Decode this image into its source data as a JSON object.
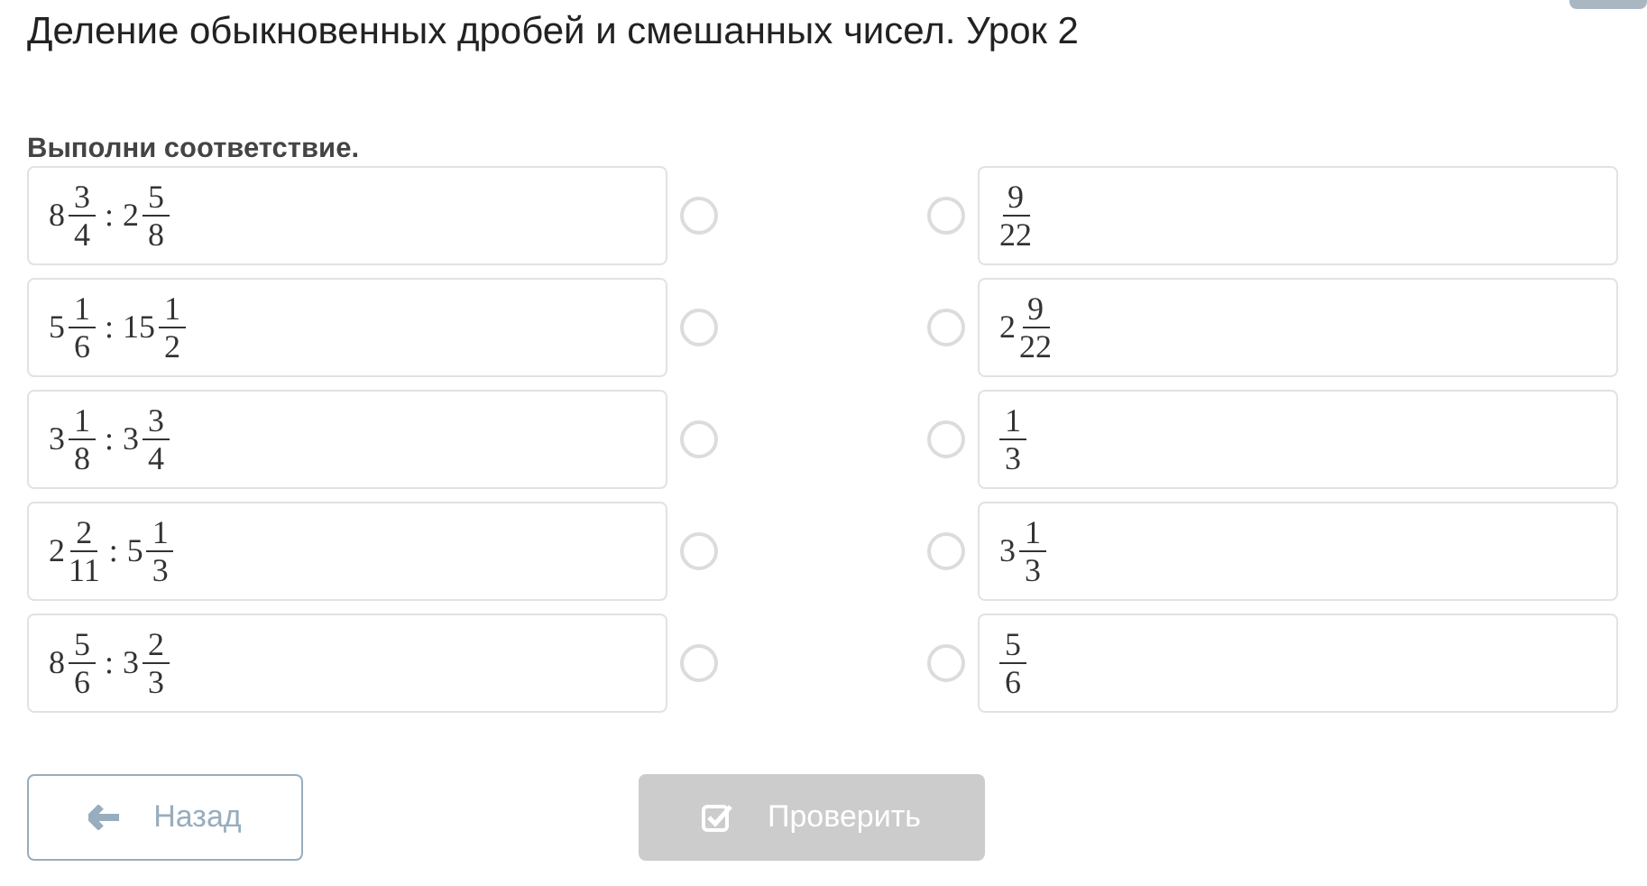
{
  "title": "Деление обыкновенных дробей и смешанных чисел. Урок 2",
  "instruction": "Выполни соответствие.",
  "left_items": [
    {
      "terms": [
        {
          "whole": "8",
          "num": "3",
          "den": "4"
        },
        {
          "whole": "2",
          "num": "5",
          "den": "8"
        }
      ],
      "operator": ":",
      "selected": false
    },
    {
      "terms": [
        {
          "whole": "5",
          "num": "1",
          "den": "6"
        },
        {
          "whole": "15",
          "num": "1",
          "den": "2"
        }
      ],
      "operator": ":",
      "selected": false
    },
    {
      "terms": [
        {
          "whole": "3",
          "num": "1",
          "den": "8"
        },
        {
          "whole": "3",
          "num": "3",
          "den": "4"
        }
      ],
      "operator": ":",
      "selected": false
    },
    {
      "terms": [
        {
          "whole": "2",
          "num": "2",
          "den": "11"
        },
        {
          "whole": "5",
          "num": "1",
          "den": "3"
        }
      ],
      "operator": ":",
      "selected": false
    },
    {
      "terms": [
        {
          "whole": "8",
          "num": "5",
          "den": "6"
        },
        {
          "whole": "3",
          "num": "2",
          "den": "3"
        }
      ],
      "operator": ":",
      "selected": false
    }
  ],
  "right_items": [
    {
      "terms": [
        {
          "num": "9",
          "den": "22"
        }
      ],
      "selected": false
    },
    {
      "terms": [
        {
          "whole": "2",
          "num": "9",
          "den": "22"
        }
      ],
      "selected": false
    },
    {
      "terms": [
        {
          "num": "1",
          "den": "3"
        }
      ],
      "selected": false
    },
    {
      "terms": [
        {
          "whole": "3",
          "num": "1",
          "den": "3"
        }
      ],
      "selected": false
    },
    {
      "terms": [
        {
          "num": "5",
          "den": "6"
        }
      ],
      "selected": false
    }
  ],
  "buttons": {
    "back": {
      "label": "Назад",
      "disabled": false
    },
    "check": {
      "label": "Проверить",
      "disabled": true
    }
  }
}
